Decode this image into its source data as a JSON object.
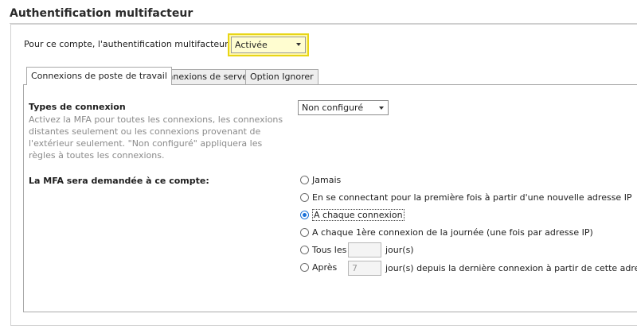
{
  "section": {
    "title": "Authentification multifacteur"
  },
  "mfa": {
    "label": "Pour ce compte, l'authentification multifacteur est",
    "status_value": "Activée"
  },
  "tabs": [
    {
      "label": "Connexions de poste de travail",
      "active": true
    },
    {
      "label": "Connexions de serveur",
      "active": false
    },
    {
      "label": "Option Ignorer",
      "active": false
    }
  ],
  "connection_types": {
    "label": "Types de connexion",
    "description": "Activez la MFA pour toutes les connexions, les connexions distantes seulement ou les connexions provenant de l'extérieur seulement. \"Non configuré\" appliquera les règles à toutes les connexions.",
    "selected": "Non configuré"
  },
  "mfa_required": {
    "label": "La MFA sera demandée à ce compte:",
    "options": [
      {
        "label": "Jamais",
        "checked": false
      },
      {
        "label": "En se connectant pour la première fois à partir d'une nouvelle adresse IP",
        "checked": false
      },
      {
        "label": "A chaque connexion",
        "checked": true
      },
      {
        "label": "A chaque 1ère connexion de la journée (une fois par adresse IP)",
        "checked": false
      },
      {
        "label": "Tous les",
        "checked": false,
        "value": "",
        "suffix": "jour(s)"
      },
      {
        "label": "Après",
        "checked": false,
        "value": "7",
        "suffix": "jour(s) depuis la dernière connexion à partir de cette adresse IP"
      }
    ]
  },
  "colors": {
    "highlight": "#fff8a6",
    "highlight_border": "#e8d516",
    "radio_accent": "#1c71d8"
  }
}
